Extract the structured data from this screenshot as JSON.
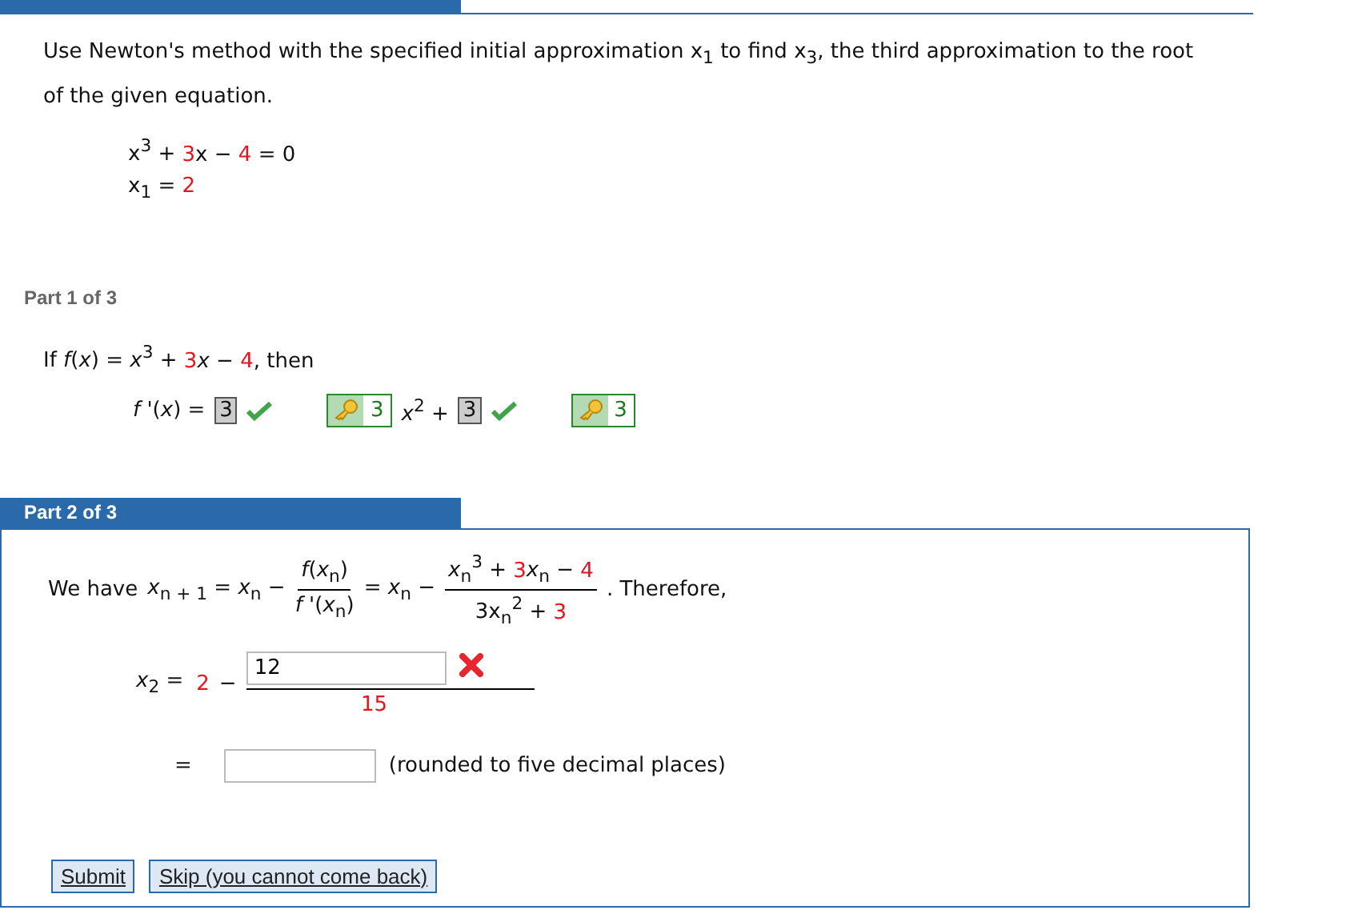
{
  "problem": {
    "statement": "Use Newton's method with the specified initial approximation x$_{1}$ to find x$_{3}$, the third approximation to the root of the given equation.",
    "equation": [
      {
        "t": "x$^{3}$ + ",
        "given": false
      },
      {
        "t": "3",
        "given": true
      },
      {
        "t": "x − ",
        "given": false
      },
      {
        "t": "4",
        "given": true
      },
      {
        "t": " = 0",
        "given": false
      }
    ],
    "initial": [
      {
        "t": "x$_{1}$ = ",
        "given": false
      },
      {
        "t": "2",
        "given": true
      }
    ]
  },
  "parts": [
    {
      "title": "Part 1 of 3",
      "kind": "done",
      "lead": [
        {
          "t": "If  *f*(*x*) = *x*$^{3}$ + ",
          "given": false
        },
        {
          "t": "3",
          "given": true
        },
        {
          "t": "*x* − ",
          "given": false
        },
        {
          "t": "4",
          "given": true
        },
        {
          "t": ",  then",
          "given": false
        }
      ],
      "derivative_label": "*f* '(*x*) =",
      "terms": [
        {
          "answer": "3",
          "correct": true,
          "key": "3",
          "suffix": "*x*$^{2}$ +"
        },
        {
          "answer": "3",
          "correct": true,
          "key": "3"
        }
      ]
    },
    {
      "title": "Part 2 of 3",
      "kind": "current",
      "lead": "We have",
      "lhs": "*x*$_{n + 1}$ = *x*$_{n}$ −",
      "frac1": {
        "num": [
          {
            "t": "*f*(*x*$_{n}$)",
            "given": false
          }
        ],
        "den": [
          {
            "t": "*f* '(*x*$_{n}$)",
            "given": false
          }
        ]
      },
      "mid": "= *x*$_{n}$ −",
      "frac2": {
        "num": [
          {
            "t": "*x*$_{n}$$^{3}$ + ",
            "given": false
          },
          {
            "t": "3",
            "given": true
          },
          {
            "t": "*x*$_{n}$ − ",
            "given": false
          },
          {
            "t": "4",
            "given": true
          }
        ],
        "den": [
          {
            "t": "3x$_{n}$$^{2}$ + ",
            "given": false
          },
          {
            "t": "3",
            "given": true
          }
        ]
      },
      "tail": ". Therefore,",
      "step": {
        "lhs": "*x*$_{2}$  =",
        "start": "2",
        "minus": "−",
        "numerator": "12",
        "correct": false,
        "denominator": "15"
      },
      "result": {
        "eq": "=",
        "note": "(rounded to five decimal places)"
      },
      "buttons": [
        "Submit",
        "Skip (you cannot come back)"
      ]
    }
  ]
}
